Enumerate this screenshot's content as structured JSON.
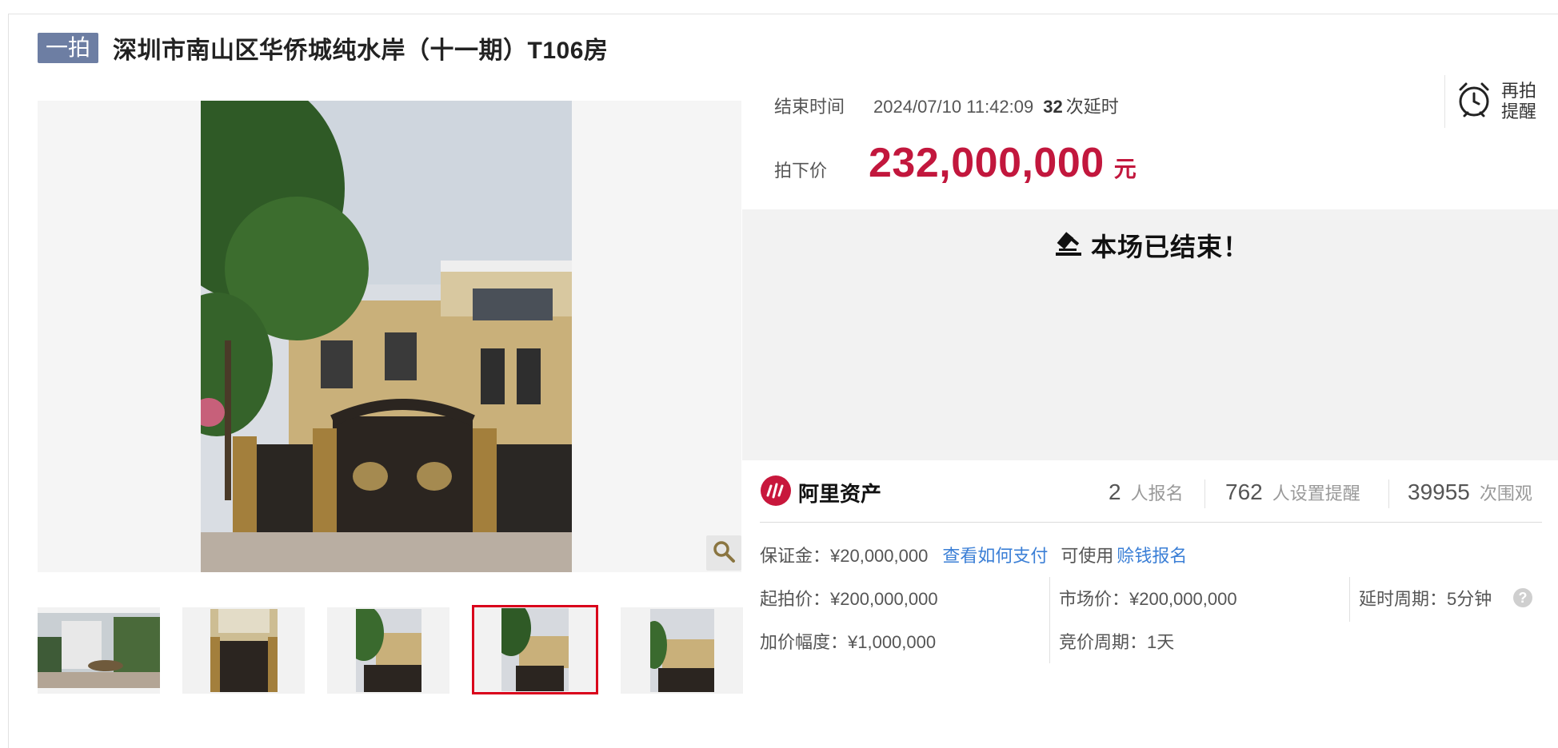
{
  "title": {
    "tag": "一拍",
    "text": "深圳市南山区华侨城纯水岸（十一期）T106房"
  },
  "auction": {
    "end_label": "结束时间",
    "end_time": "2024/07/10 11:42:09",
    "extension_count": "32",
    "extension_unit": "次延时",
    "price_label": "拍下价",
    "price_value": "232,000,000",
    "price_unit": "元",
    "ended_text": "本场已结束！"
  },
  "remind": {
    "line1": "再拍",
    "line2": "提醒"
  },
  "brand": {
    "name": "阿里资产"
  },
  "stats": [
    {
      "num": "2",
      "unit": "人报名"
    },
    {
      "num": "762",
      "unit": "人设置提醒"
    },
    {
      "num": "39955",
      "unit": "次围观"
    }
  ],
  "deposit": {
    "text": "保证金：¥20,000,000",
    "pay_link": "查看如何支付",
    "avail_text": "可使用",
    "earn_link": "赊钱报名"
  },
  "details": {
    "start_price": "起拍价：¥200,000,000",
    "market_price": "市场价：¥200,000,000",
    "extend_period": "延时周期：5分钟",
    "increment": "加价幅度：¥1,000,000",
    "bid_period": "竞价周期：1天"
  },
  "colors": {
    "accent": "#c2173d",
    "tag_bg": "#6d7ea3",
    "link": "#3b7fd6",
    "thumb_active": "#d9001b"
  },
  "icons": [
    "magnifier-icon",
    "alarm-clock-icon",
    "gavel-icon",
    "ali-asset-logo-icon",
    "help-icon"
  ]
}
